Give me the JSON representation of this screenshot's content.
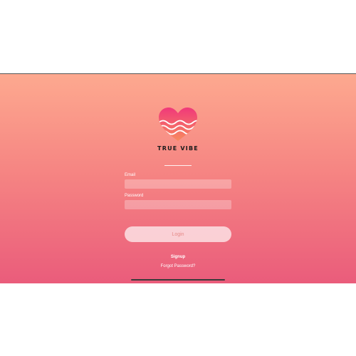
{
  "app": {
    "brand_name": "TRUE VIBE",
    "logo_icon": "heart-wave-icon"
  },
  "form": {
    "email_label": "Email",
    "email_value": "",
    "email_placeholder": "",
    "password_label": "Password",
    "password_value": "",
    "password_placeholder": ""
  },
  "actions": {
    "login_label": "Login",
    "signup_label": "Signup",
    "forgot_label": "Forgot Password?"
  },
  "colors": {
    "gradient_top": "#fda98f",
    "gradient_mid": "#f68683",
    "gradient_bottom": "#ea5c7b",
    "heart_top": "#f0387a",
    "heart_bottom": "#f78b5f",
    "brand_text": "#1b1b1b",
    "login_text": "#e68a88"
  }
}
